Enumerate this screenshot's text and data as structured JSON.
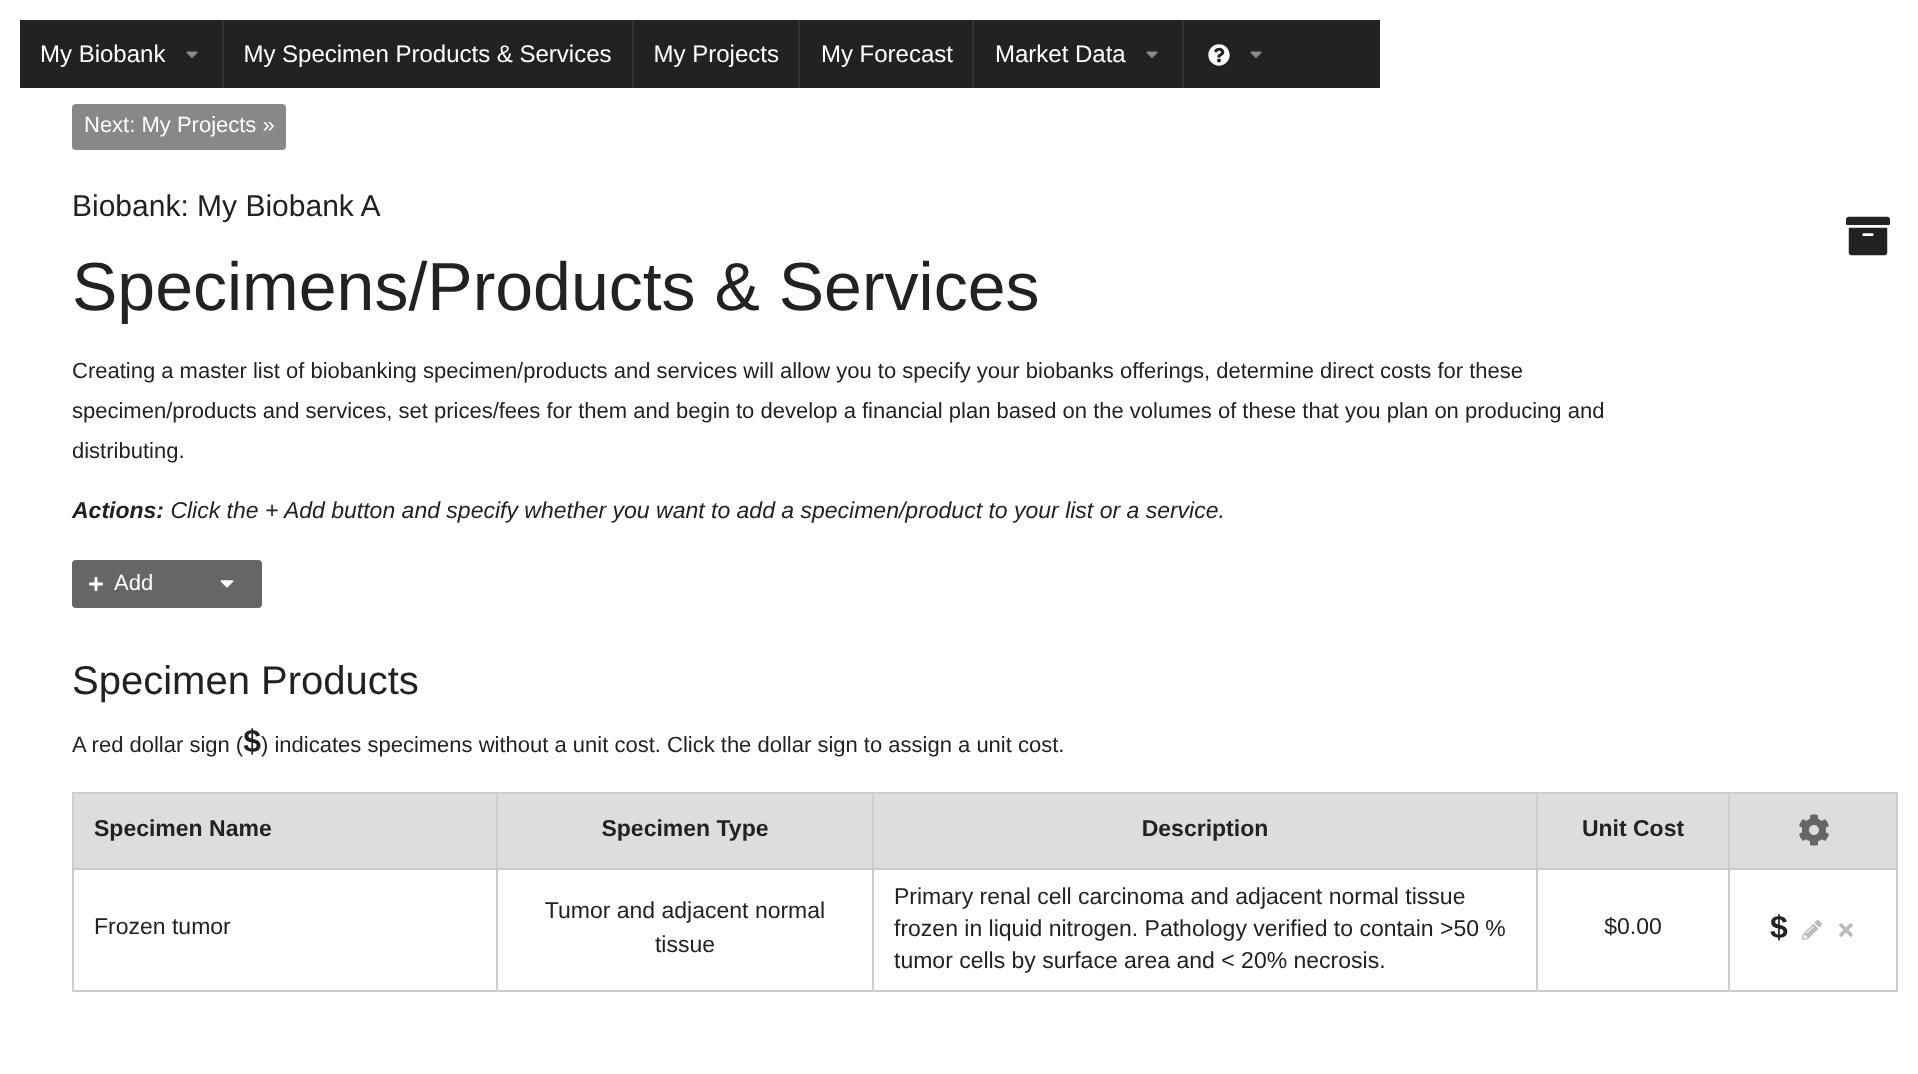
{
  "nav": {
    "items": [
      {
        "label": "My Biobank",
        "dropdown": true
      },
      {
        "label": "My Specimen Products & Services",
        "dropdown": false
      },
      {
        "label": "My Projects",
        "dropdown": false
      },
      {
        "label": "My Forecast",
        "dropdown": false
      },
      {
        "label": "Market Data",
        "dropdown": true
      }
    ],
    "help_dropdown": true
  },
  "next_button": "Next: My Projects »",
  "biobank": "Biobank: My Biobank A",
  "title": "Specimens/Products & Services",
  "intro": "Creating a master list of biobanking specimen/products and services will allow you to specify your biobanks offerings, determine direct costs for these specimen/products and services, set prices/fees for them and begin to develop a financial plan based on the volumes of these that you plan on producing and distributing.",
  "actions": "**Actions:** Click the + Add button and specify whether you want to add a specimen/product to your list or a service.",
  "add_button": "Add",
  "section": {
    "title": "Specimen Products",
    "note_before": "A red dollar sign (",
    "note_sign": "$",
    "note_after": ") indicates specimens without a unit cost. Click the dollar sign to assign a unit cost."
  },
  "table": {
    "columns": [
      "Specimen Name",
      "Specimen Type",
      "Description",
      "Unit Cost"
    ],
    "rows": [
      {
        "name": "Frozen tumor",
        "type": "Tumor and adjacent normal tissue",
        "description": "Primary renal cell carcinoma and adjacent normal tissue frozen in liquid nitrogen. Pathology verified to contain >50 % tumor cells by surface area and < 20% necrosis.",
        "unit_cost": "$0.00",
        "cost_action": "$"
      }
    ]
  }
}
